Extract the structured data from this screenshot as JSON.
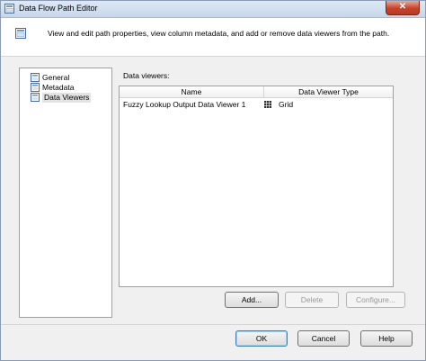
{
  "window": {
    "title": "Data Flow Path Editor",
    "close_glyph": "✕"
  },
  "header": {
    "description": "View and edit path properties, view column metadata, and add or remove data viewers from the path."
  },
  "nav": {
    "items": [
      {
        "label": "General",
        "icon": "page-icon"
      },
      {
        "label": "Metadata",
        "icon": "page-icon"
      },
      {
        "label": "Data Viewers",
        "icon": "page-icon",
        "selected": true
      }
    ]
  },
  "viewers": {
    "label": "Data viewers:",
    "columns": [
      "Name",
      "Data Viewer Type"
    ],
    "rows": [
      {
        "name": "Fuzzy Lookup Output Data Viewer 1",
        "type": "Grid",
        "type_icon": "grid-icon"
      }
    ]
  },
  "actions": {
    "add": "Add...",
    "delete": "Delete",
    "configure": "Configure..."
  },
  "footer": {
    "ok": "OK",
    "cancel": "Cancel",
    "help": "Help"
  },
  "colors": {
    "accent": "#3c7fb1",
    "close": "#c5432a"
  }
}
